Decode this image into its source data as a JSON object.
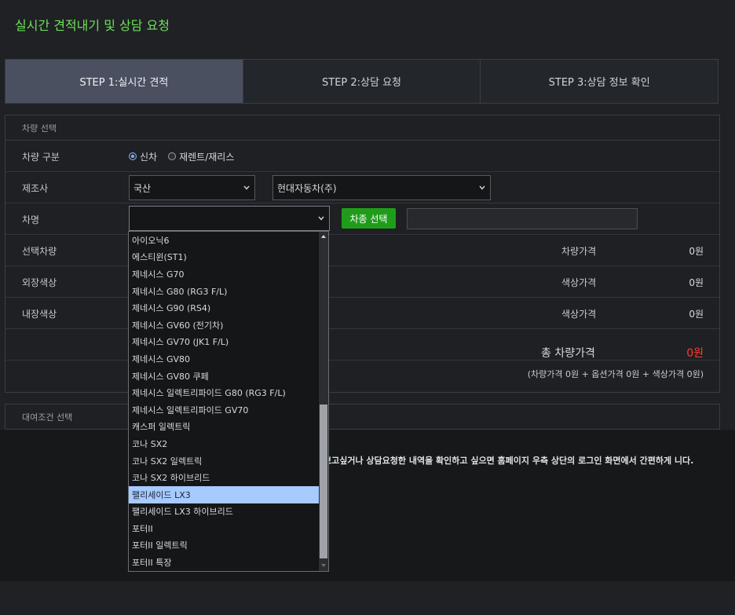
{
  "title": "실시간 견적내기 및 상담 요청",
  "steps": [
    {
      "label": "STEP 1:실시간 견적"
    },
    {
      "label": "STEP 2:상담 요청"
    },
    {
      "label": "STEP 3:상담 정보 확인"
    }
  ],
  "vehicle_section": {
    "heading": "차량 선택",
    "type_label": "차량 구분",
    "type_options": [
      "신차",
      "재렌트/재리스"
    ],
    "type_selected": "신차",
    "maker_label": "제조사",
    "maker_origin": "국산",
    "maker_brand": "현대자동차(주)",
    "model_label": "차명",
    "model_button": "차종 선택",
    "selected_label": "선택차량",
    "exterior_label": "외장색상",
    "interior_label": "내장색상",
    "price_car_label": "차량가격",
    "price_car_value": "0원",
    "price_ext_label": "색상가격",
    "price_ext_value": "0원",
    "price_int_label": "색상가격",
    "price_int_value": "0원",
    "total_label": "총 차량가격",
    "total_value": "0원",
    "breakdown": "(차량가격 0원 + 옵션가격 0원 + 색상가격 0원)"
  },
  "rental_section": {
    "heading": "대여조건 선택"
  },
  "notice_text": "보고싶거나 상담요청한 내역을 확인하고 싶으면 홈페이지 우측 상단의 로그인 화면에서 간편하게 니다.",
  "model_dropdown": {
    "options": [
      "아이오닉6",
      "에스티윈(ST1)",
      "제네시스 G70",
      "제네시스 G80 (RG3 F/L)",
      "제네시스 G90 (RS4)",
      "제네시스 GV60 (전기차)",
      "제네시스 GV70 (JK1 F/L)",
      "제네시스 GV80",
      "제네시스 GV80 쿠페",
      "제네시스 일렉트리파이드 G80 (RG3 F/L)",
      "제네시스 일렉트리파이드 GV70",
      "캐스퍼 일렉트릭",
      "코나 SX2",
      "코나 SX2 일렉트릭",
      "코나 SX2 하이브리드",
      "팰리세이드 LX3",
      "팰리세이드 LX3 하이브리드",
      "포터II",
      "포터II 일렉트릭",
      "포터II 특장"
    ],
    "highlighted": "팰리세이드 LX3"
  },
  "colors": {
    "title": "#6ee05a",
    "active_step": "#4a5060",
    "button_green": "#1f9d1a",
    "total_red": "#ff3b30",
    "highlight": "#a7caff"
  }
}
